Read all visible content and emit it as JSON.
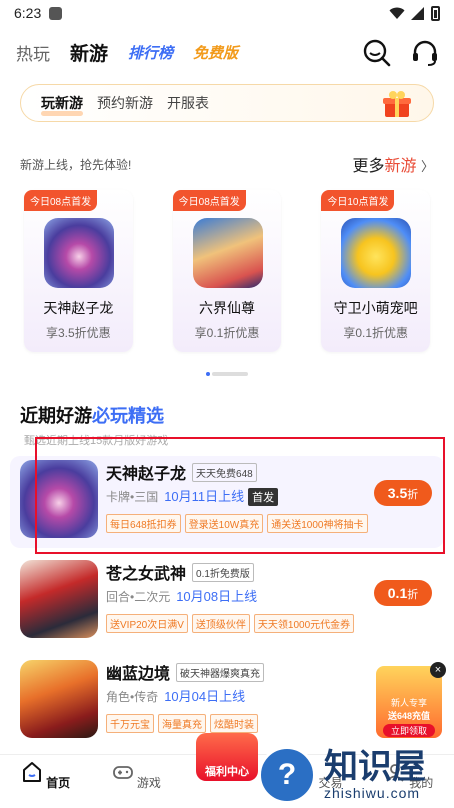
{
  "status": {
    "time": "6:23"
  },
  "nav": {
    "tabs": [
      {
        "label": "热玩"
      },
      {
        "label": "新游"
      },
      {
        "label": "排行榜"
      },
      {
        "label": "免费版"
      }
    ]
  },
  "subtabs": [
    {
      "label": "玩新游"
    },
    {
      "label": "预约新游"
    },
    {
      "label": "开服表"
    }
  ],
  "new_section": {
    "desc": "新游上线，抢先体验!",
    "more_prefix": "更多",
    "more_accent": "新游",
    "more_arrow": "〉",
    "cards": [
      {
        "badge": "今日08点首发",
        "name": "天神赵子龙",
        "offer": "享3.5折优惠"
      },
      {
        "badge": "今日08点首发",
        "name": "六界仙尊",
        "offer": "享0.1折优惠"
      },
      {
        "badge": "今日10点首发",
        "name": "守卫小萌宠吧",
        "offer": "享0.1折优惠"
      }
    ]
  },
  "recent_section": {
    "title_main": "近期好游",
    "title_accent": "必玩精选",
    "desc": "甄选近期上线15款月版好游戏"
  },
  "games": [
    {
      "name": "天神赵子龙",
      "tag": "天天免费648",
      "genre": "卡牌•三国",
      "date": "10月11日上线",
      "badge": "首发",
      "discount": "3.5",
      "discount_unit": "折",
      "perks": [
        "每日648抵扣券",
        "登录送10W真充",
        "通关送1000神将抽卡"
      ]
    },
    {
      "name": "苍之女武神",
      "tag": "0.1折免费版",
      "genre": "回合•二次元",
      "date": "10月08日上线",
      "discount": "0.1",
      "discount_unit": "折",
      "perks": [
        "送VIP20次日满V",
        "送顶级伙伴",
        "天天领1000元代金券"
      ]
    },
    {
      "name": "幽蓝边境",
      "tag": "破天神器爆爽真充",
      "genre": "角色•传奇",
      "date": "10月04日上线",
      "perks": [
        "千万元宝",
        "海量真充",
        "炫酷时装"
      ]
    }
  ],
  "float_gift": {
    "line1": "新人专享",
    "line2": "送648充值",
    "btn": "立即领取",
    "close": "×"
  },
  "bottom_nav": {
    "items": [
      {
        "label": "首页"
      },
      {
        "label": "游戏"
      },
      {
        "label": "福利中心"
      },
      {
        "label": "交易"
      },
      {
        "label": "我的"
      }
    ]
  },
  "watermark": {
    "cn": "知识屋",
    "en": "zhishiwu.com",
    "symbol": "?"
  },
  "colors": {
    "accent_red": "#e94b36",
    "accent_blue": "#3d6ef5",
    "discount": "#f05a1c",
    "highlight": "#e8102a"
  }
}
